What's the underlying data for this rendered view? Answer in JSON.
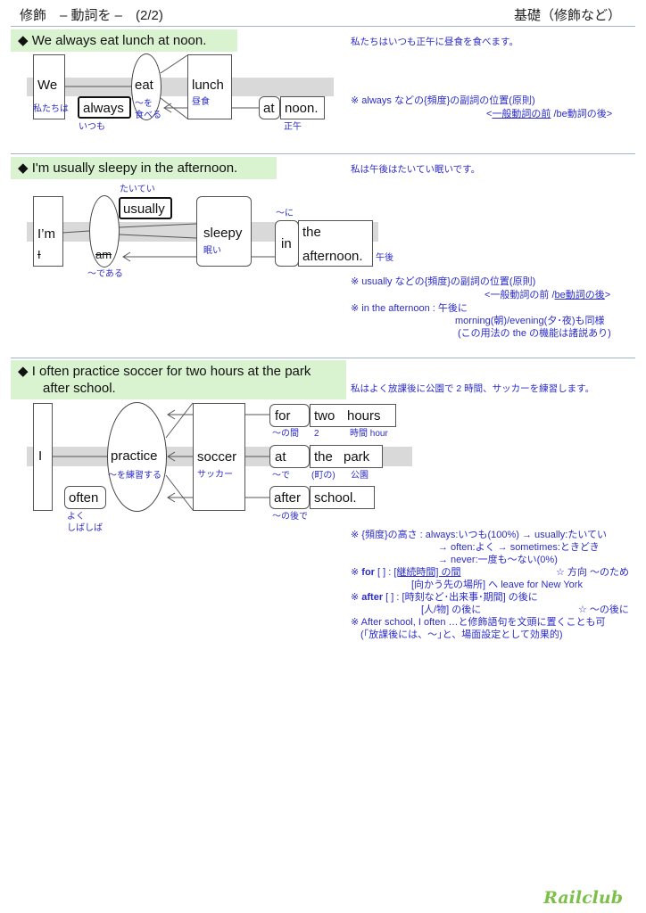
{
  "header": {
    "title": "修飾　– 動詞を –　(2/2)",
    "category": "基礎（修飾など）"
  },
  "section1": {
    "bullet": "◆",
    "sentence": "We always eat lunch at noon.",
    "translation": "私たちはいつも正午に昼食を食べます。",
    "words": {
      "subject": "We",
      "subject_jp": "私たちは",
      "adverb": "always",
      "adverb_jp": "いつも",
      "verb": "eat",
      "verb_jp": "～を\n食べる",
      "object": "lunch",
      "object_jp": "昼食",
      "prep": "at",
      "prep_obj": "noon.",
      "prep_obj_jp": "正午"
    },
    "notes": [
      "※ always などの{頻度}の副詞の位置(原則)",
      "<一般動詞の前 /be動詞の後>"
    ],
    "note_underlined": "一般動詞の前",
    "note_rest_prefix": "<",
    "note_rest_suffix": " /be動詞の後>"
  },
  "section2": {
    "bullet": "◆",
    "sentence": "I'm usually sleepy in the afternoon.",
    "translation": "私は午後はたいてい眠いです。",
    "words": {
      "subject": "I’m",
      "subject_struck": "I",
      "verb_struck": "am",
      "verb_jp": "～である",
      "adverb": "usually",
      "adverb_jp": "たいてい",
      "complement": "sleepy",
      "complement_jp": "眠い",
      "prep": "in",
      "prep_jp": "～に",
      "article": "the",
      "noun": "afternoon.",
      "noun_jp": "午後"
    },
    "notes": {
      "line1": "※ usually などの{頻度}の副詞の位置(原則)",
      "line2_prefix": "<一般動詞の前 /",
      "line2_underlined": "be動詞の後",
      "line2_suffix": ">",
      "line3": "※ in the afternoon :  午後に",
      "line4": "morning(朝)/evening(夕･夜)も同様",
      "line5": "(この用法の the の機能は諸説あり)"
    }
  },
  "section3": {
    "bullet": "◆",
    "sentence_line1": "I often practice soccer for two hours at the park",
    "sentence_line2": "after school.",
    "translation": "私はよく放課後に公園で 2 時間、サッカーを練習します。",
    "words": {
      "subject": "I",
      "verb": "practice",
      "verb_jp": "～を練習する",
      "adverb": "often",
      "adverb_jp": "よく\nしばしば",
      "object": "soccer",
      "object_jp": "サッカー",
      "pp1_prep": "for",
      "pp1_mod": "two",
      "pp1_noun": "hours",
      "pp1_prep_jp": "～の間",
      "pp1_mod_jp": "2",
      "pp1_noun_jp": "時間 hour",
      "pp2_prep": "at",
      "pp2_mod": "the",
      "pp2_noun": "park",
      "pp2_prep_jp": "～で",
      "pp2_mod_jp": "(町の)",
      "pp2_noun_jp": "公園",
      "pp3_prep": "after",
      "pp3_noun": "school.",
      "pp3_prep_jp": "～の後で"
    },
    "notes": {
      "freq1": "※ {頻度}の高さ :  always:いつも(100%) → usually:たいてい",
      "freq2": "→ often:よく → sometimes:ときどき",
      "freq3": "→ never:一度も～ない(0%)",
      "for_prefix": "※ ",
      "for_word": "for",
      "for_bracket": " [ ] :  ",
      "for_meaning1": "[継続時間] の間",
      "for_star": "☆ 方向 ～のため",
      "for_meaning2": "[向かう先の場所] へ leave for New York",
      "after_prefix": "※ ",
      "after_word": "after",
      "after_bracket": " [ ] :  ",
      "after_meaning1": "[時刻など･出来事･期間] の後に",
      "after_meaning2": "[人/物] の後に",
      "after_star": "☆ ～の後に",
      "tip1": "※ After school, I often …と修飾語句を文頭に置くことも可",
      "tip2": "(｢放課後には、～｣と、場面設定として効果的)"
    }
  },
  "footer": {
    "logo": "Railclub"
  },
  "colors": {
    "accent_blue": "#2b2bc8",
    "sentence_bg": "#d9f2cf",
    "band": "#d9d9d9",
    "logo": "#7cc04a",
    "rule": "#9fb4d0"
  }
}
